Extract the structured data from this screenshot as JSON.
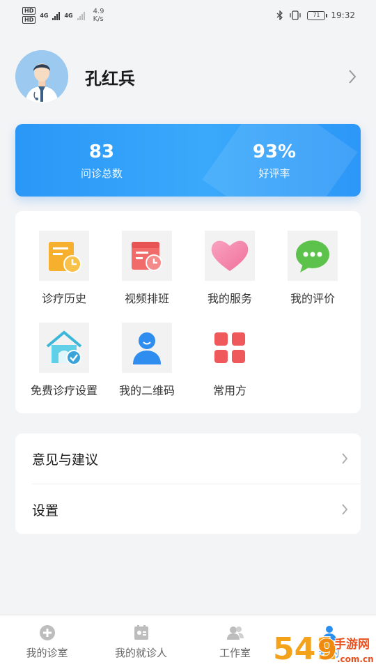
{
  "status_bar": {
    "hd1": "HD",
    "hd2": "HD",
    "net1": "4G",
    "net2": "4G",
    "speed_value": "4.9",
    "speed_unit": "K/s",
    "battery": "71",
    "time": "19:32"
  },
  "profile": {
    "name": "孔红兵"
  },
  "stats": {
    "consult_count": "83",
    "consult_label": "问诊总数",
    "rating": "93%",
    "rating_label": "好评率"
  },
  "features": [
    {
      "label": "诊疗历史",
      "icon": "clipboard-clock-icon"
    },
    {
      "label": "视频排班",
      "icon": "calendar-clock-icon"
    },
    {
      "label": "我的服务",
      "icon": "heart-icon"
    },
    {
      "label": "我的评价",
      "icon": "chat-bubble-icon"
    },
    {
      "label": "免费诊疗设置",
      "icon": "house-check-icon"
    },
    {
      "label": "我的二维码",
      "icon": "user-icon"
    },
    {
      "label": "常用方",
      "icon": "grid-icon"
    }
  ],
  "menu": {
    "feedback": "意见与建议",
    "settings": "设置"
  },
  "nav": {
    "clinic": "我的诊室",
    "patients": "我的就诊人",
    "workroom": "工作室",
    "mine": "我的"
  },
  "colors": {
    "accent": "#2b8ff0",
    "stats_bg": "#2a97f7"
  },
  "watermark": {
    "text": "54119手游网",
    "url_text": ".com.cn"
  }
}
